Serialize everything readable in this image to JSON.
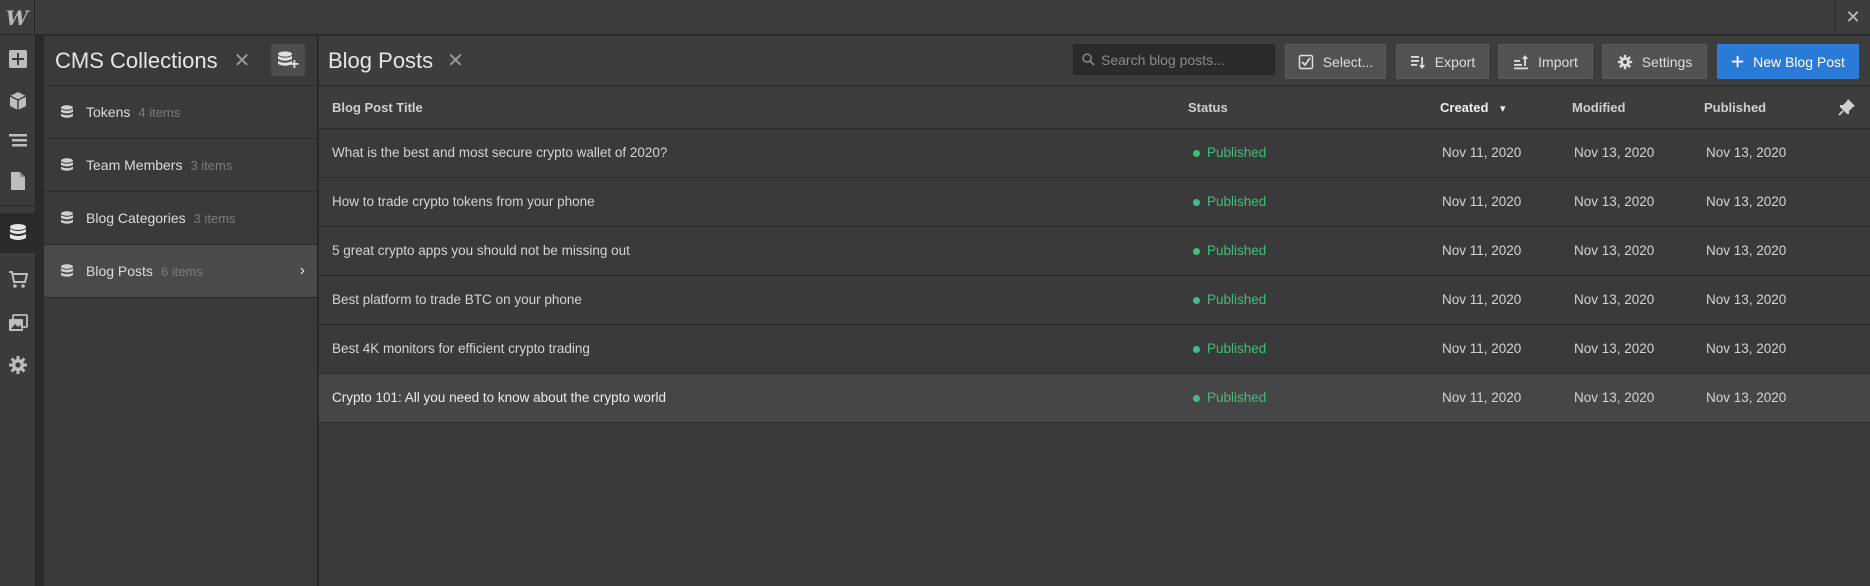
{
  "app": {
    "logo": "W",
    "close_glyph": "✕"
  },
  "rail": {
    "items": [
      {
        "icon": "add-icon"
      },
      {
        "icon": "cube-icon"
      },
      {
        "icon": "navigator-icon"
      },
      {
        "icon": "pages-icon"
      },
      {
        "icon": "cms-icon",
        "active": true
      },
      {
        "icon": "ecommerce-icon"
      },
      {
        "icon": "assets-icon"
      },
      {
        "icon": "settings-icon"
      }
    ]
  },
  "collections": {
    "title": "CMS Collections",
    "close_glyph": "✕",
    "items": [
      {
        "name": "Tokens",
        "count": "4 items"
      },
      {
        "name": "Team Members",
        "count": "3 items"
      },
      {
        "name": "Blog Categories",
        "count": "3 items"
      },
      {
        "name": "Blog Posts",
        "count": "6 items",
        "active": true
      }
    ],
    "chevron": "›"
  },
  "main": {
    "title": "Blog Posts",
    "close_glyph": "✕",
    "search": {
      "placeholder": "Search blog posts..."
    },
    "buttons": {
      "select": "Select...",
      "export": "Export",
      "import": "Import",
      "settings": "Settings",
      "new": "New Blog Post"
    },
    "columns": {
      "title": "Blog Post Title",
      "status": "Status",
      "created": "Created",
      "modified": "Modified",
      "published": "Published"
    },
    "sort_glyph": "▾",
    "rows": [
      {
        "title": "What is the best and most secure crypto wallet of 2020?",
        "status": "Published",
        "created": "Nov 11, 2020",
        "modified": "Nov 13, 2020",
        "published": "Nov 13, 2020"
      },
      {
        "title": "How to trade crypto tokens from your phone",
        "status": "Published",
        "created": "Nov 11, 2020",
        "modified": "Nov 13, 2020",
        "published": "Nov 13, 2020"
      },
      {
        "title": "5 great crypto apps you should not be missing out",
        "status": "Published",
        "created": "Nov 11, 2020",
        "modified": "Nov 13, 2020",
        "published": "Nov 13, 2020"
      },
      {
        "title": "Best platform to trade BTC on your phone",
        "status": "Published",
        "created": "Nov 11, 2020",
        "modified": "Nov 13, 2020",
        "published": "Nov 13, 2020"
      },
      {
        "title": "Best 4K monitors for efficient crypto trading",
        "status": "Published",
        "created": "Nov 11, 2020",
        "modified": "Nov 13, 2020",
        "published": "Nov 13, 2020"
      },
      {
        "title": "Crypto 101: All you need to know about the crypto world",
        "status": "Published",
        "created": "Nov 11, 2020",
        "modified": "Nov 13, 2020",
        "published": "Nov 13, 2020",
        "highlighted": true
      }
    ]
  },
  "colors": {
    "accent": "#2a7ad8",
    "published": "#3ec07a",
    "background": "#3a3a3a"
  }
}
